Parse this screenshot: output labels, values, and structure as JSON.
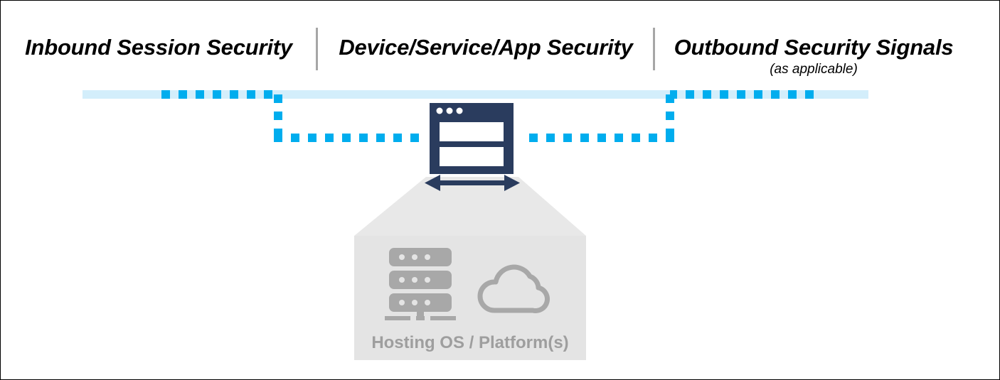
{
  "diagram": {
    "title": "Security zones across inbound session, device/service/app, and outbound signals",
    "headers": {
      "inbound": "Inbound Session Security",
      "device": "Device/Service/App Security",
      "outbound": "Outbound Security Signals",
      "outbound_sub": "(as applicable)"
    },
    "platform": {
      "caption": "Hosting OS / Platform(s)",
      "icons": [
        "server-stack-icon",
        "cloud-icon"
      ]
    },
    "center_node": {
      "icon": "app-window-icon",
      "arrow": "bidirectional-arrow"
    },
    "colors": {
      "navy": "#2a3c5e",
      "bright_blue": "#00adee",
      "pale_blue": "#d3eefb",
      "platform_gray": "#e4e4e4",
      "wedge_gray": "#e8e8e8",
      "icon_gray": "#a8a8a8",
      "caption_gray": "#9e9e9e",
      "divider_gray": "#a6a6a6",
      "border_black": "#000000"
    },
    "flow": {
      "band_label": "session-flow-band",
      "left_signal_label": "inbound-dashed-path",
      "right_signal_label": "outbound-dashed-path"
    }
  }
}
